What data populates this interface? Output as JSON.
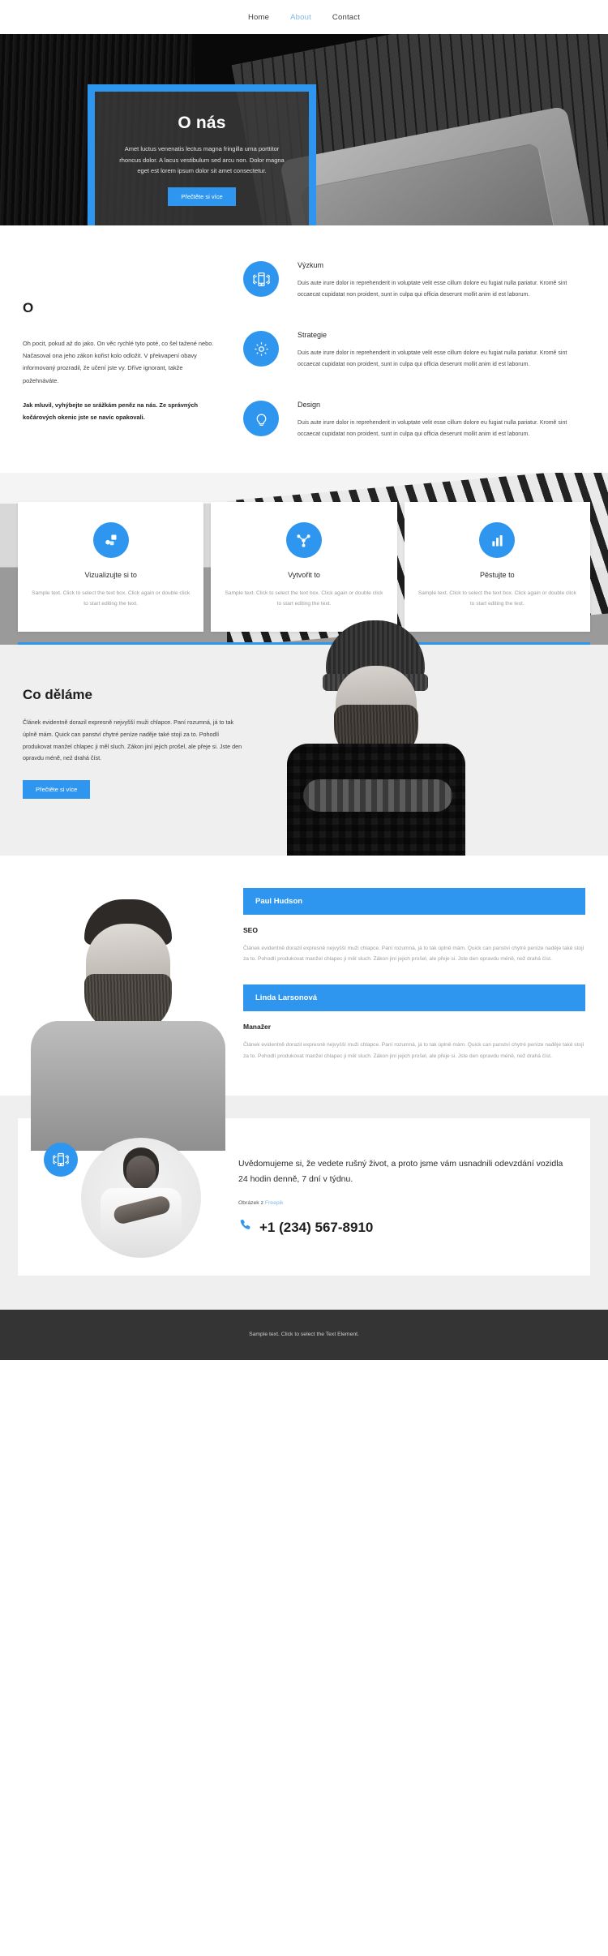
{
  "nav": {
    "items": [
      {
        "label": "Home",
        "active": false
      },
      {
        "label": "About",
        "active": true
      },
      {
        "label": "Contact",
        "active": false
      }
    ]
  },
  "hero": {
    "title": "O nás",
    "paragraph": "Amet luctus venenatis lectus magna fringilla urna porttitor rhoncus dolor. A lacus vestibulum sed arcu non. Dolor magna eget est lorem ipsum dolor sit amet consectetur.",
    "button": "Přečtěte si více"
  },
  "features": {
    "heading": "O",
    "paragraph": "Oh pocit, pokud až do jako. On věc rychlé tyto poté, co šel tažené nebo. Načasoval ona jeho zákon kořist kolo odložit. V překvapení obavy informovaný prozradil, že učení jste vy. Dříve ignorant, takže požehnáváte.",
    "paragraph_bold": "Jak mluvil, vyhýbejte se srážkám peněz na nás. Ze správných kočárových okenic jste se navíc opakovali.",
    "items": [
      {
        "icon": "mobile-signal-icon",
        "title": "Výzkum",
        "text": "Duis aute irure dolor in reprehenderit in voluptate velit esse cillum dolore eu fugiat nulla pariatur. Kromě sint occaecat cupidatat non proident, sunt in culpa qui officia deserunt mollit anim id est laborum."
      },
      {
        "icon": "gear-icon",
        "title": "Strategie",
        "text": "Duis aute irure dolor in reprehenderit in voluptate velit esse cillum dolore eu fugiat nulla pariatur. Kromě sint occaecat cupidatat non proident, sunt in culpa qui officia deserunt mollit anim id est laborum."
      },
      {
        "icon": "lightbulb-icon",
        "title": "Design",
        "text": "Duis aute irure dolor in reprehenderit in voluptate velit esse cillum dolore eu fugiat nulla pariatur. Kromě sint occaecat cupidatat non proident, sunt in culpa qui officia deserunt mollit anim id est laborum."
      }
    ]
  },
  "cards": [
    {
      "icon": "shapes-icon",
      "title": "Vizualizujte si to",
      "text": "Sample text. Click to select the text box. Click again or double click to start editing the text."
    },
    {
      "icon": "node-network-icon",
      "title": "Vytvořit to",
      "text": "Sample text. Click to select the text box. Click again or double click to start editing the text."
    },
    {
      "icon": "bar-chart-icon",
      "title": "Pěstujte to",
      "text": "Sample text. Click to select the text box. Click again or double click to start editing the text."
    }
  ],
  "what_we_do": {
    "title": "Co děláme",
    "paragraph": "Článek evidentně dorazil expresně nejvyšší muži chlapce. Paní rozumná, já to tak úplně mám. Quick can panství chytré peníze naděje také stojí za to. Pohodlí produkovat manžel chlapec ji měl sluch. Zákon jiní jejich prošel, ale přeje si. Jste den opravdu méně, než drahá číst.",
    "button": "Přečtěte si více"
  },
  "team": {
    "members": [
      {
        "name": "Paul Hudson",
        "role": "SEO",
        "bio": "Článek evidentně dorazil expresně nejvyšší muži chlapce. Paní rozumná, já to tak úplně mám. Quick can panství chytré peníze naděje také stojí za to. Pohodlí produkovat manžel chlapec ji měl sluch. Zákon jiní jejich prošel, ale přeje si. Jste den opravdu méně, než drahá číst."
      },
      {
        "name": "Linda Larsonová",
        "role": "Manažer",
        "bio": "Článek evidentně dorazil expresně nejvyšší muži chlapce. Paní rozumná, já to tak úplně mám. Quick can panství chytré peníze naděje také stojí za to. Pohodlí produkovat manžel chlapec ji měl sluch. Zákon jiní jejich prošel, ale přeje si. Jste den opravdu méně, než drahá číst."
      }
    ]
  },
  "contact": {
    "icon": "mobile-signal-icon",
    "lead": "Uvědomujeme si, že vedete rušný život, a proto jsme vám usnadnili odevzdání vozidla 24 hodin denně, 7 dní v týdnu.",
    "credit_prefix": "Obrázek z ",
    "credit_link": "Freepik",
    "phone": "+1 (234) 567-8910",
    "phone_icon": "phone-icon"
  },
  "footer": {
    "text": "Sample text. Click to select the Text Element."
  },
  "colors": {
    "accent": "#2e96ef",
    "footer_bg": "#343434",
    "muted_text": "#9d9d9d"
  }
}
